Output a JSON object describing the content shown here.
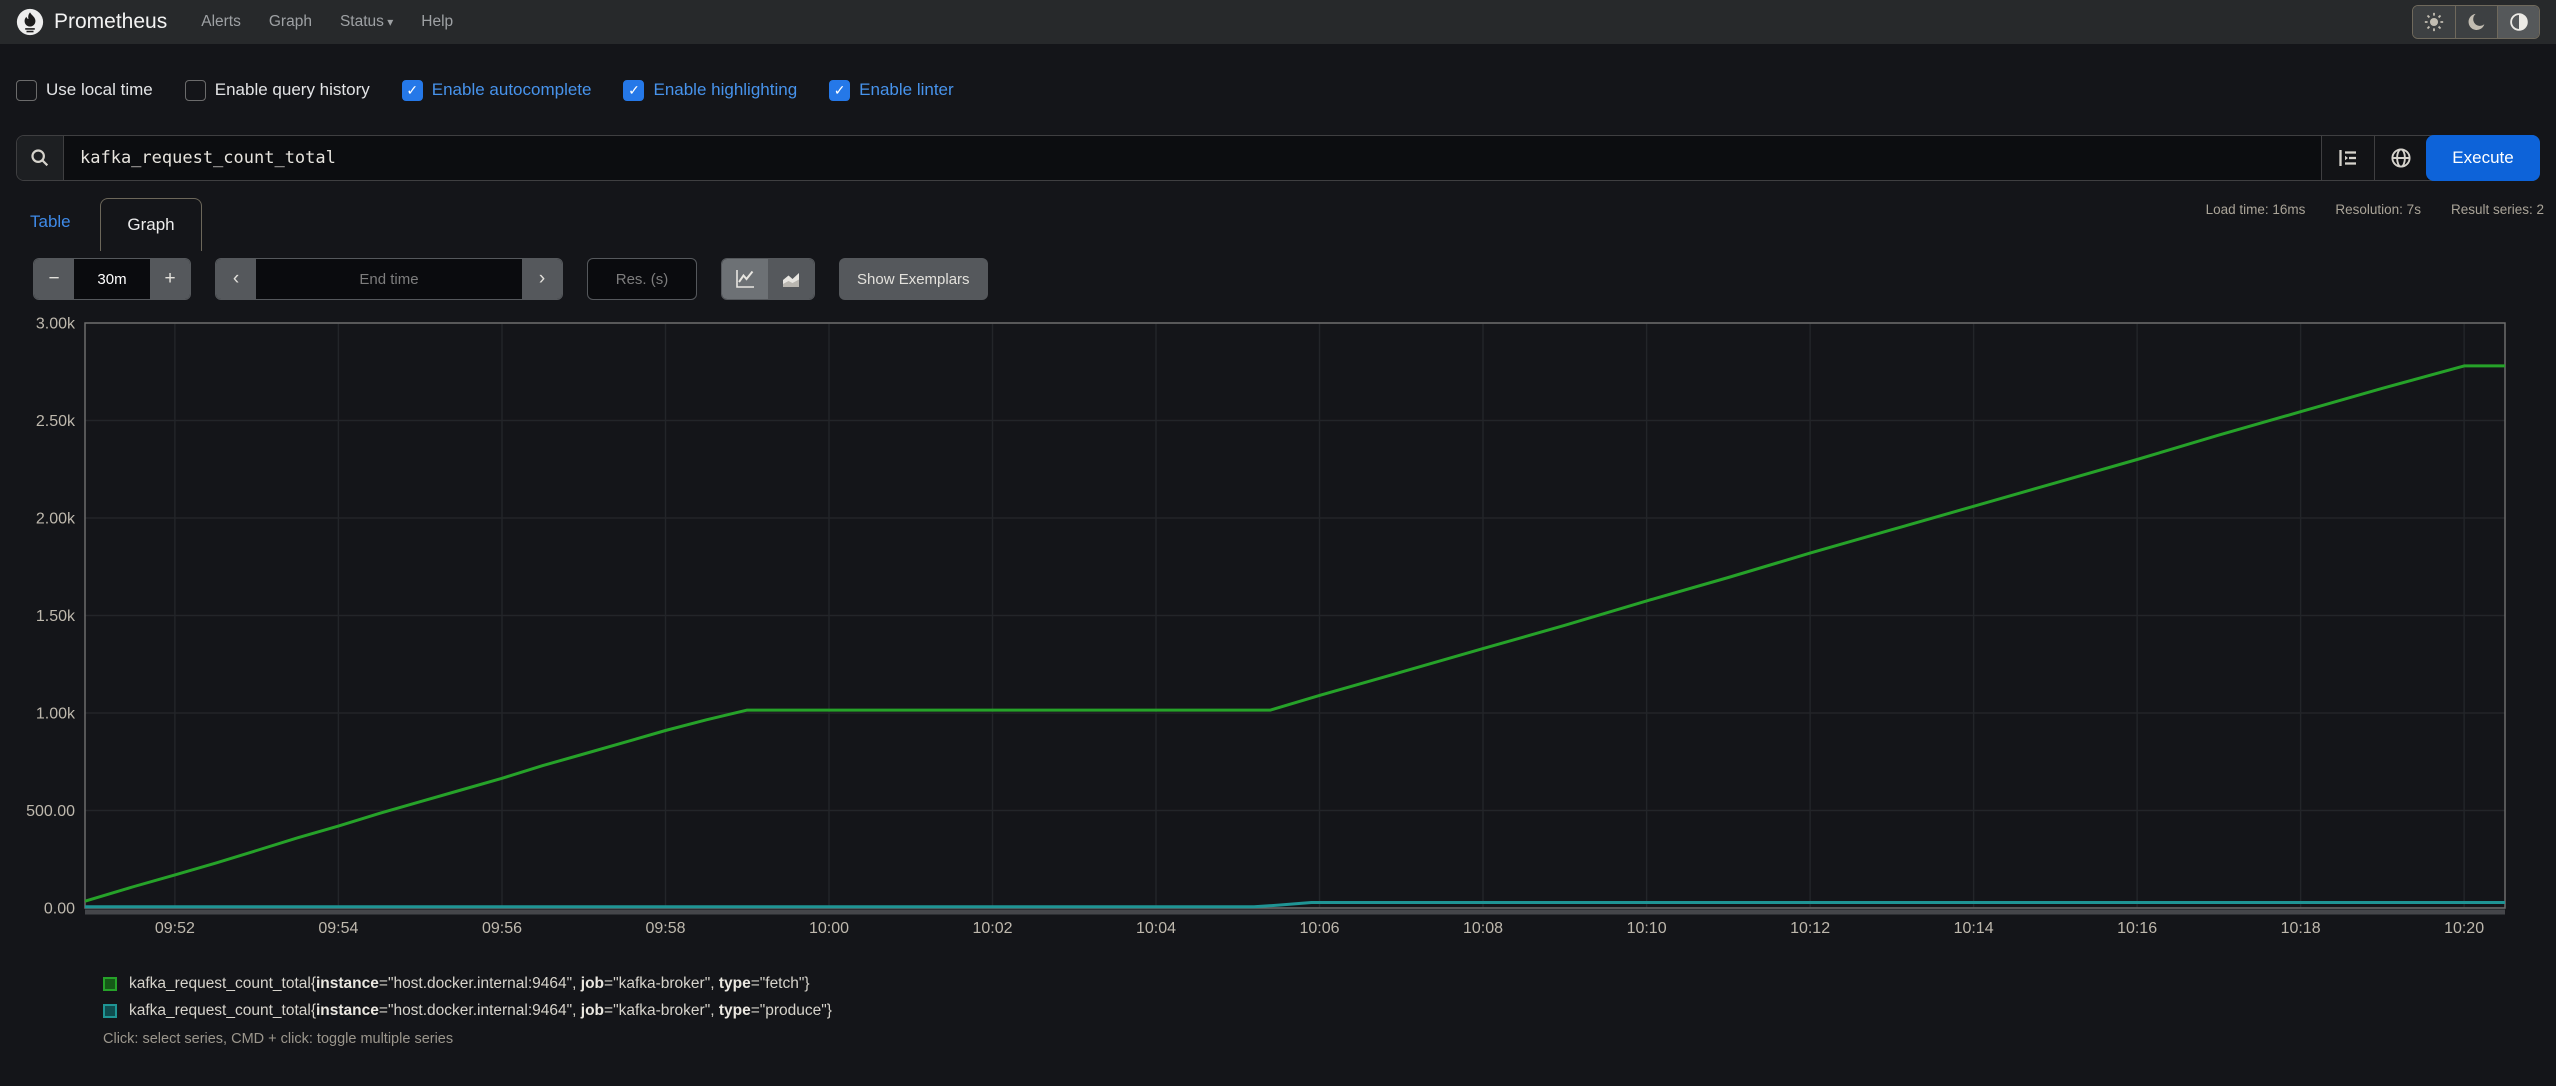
{
  "navbar": {
    "brand": "Prometheus",
    "items": [
      {
        "label": "Alerts",
        "dropdown": false
      },
      {
        "label": "Graph",
        "dropdown": false
      },
      {
        "label": "Status",
        "dropdown": true
      },
      {
        "label": "Help",
        "dropdown": false
      }
    ],
    "theme_buttons": [
      {
        "name": "light-theme-button",
        "icon": "sun-icon",
        "active": false
      },
      {
        "name": "dark-theme-button",
        "icon": "moon-icon",
        "active": false
      },
      {
        "name": "auto-theme-button",
        "icon": "half-circle-icon",
        "active": true
      }
    ]
  },
  "options": {
    "checkboxes": [
      {
        "label": "Use local time",
        "checked": false
      },
      {
        "label": "Enable query history",
        "checked": false
      },
      {
        "label": "Enable autocomplete",
        "checked": true
      },
      {
        "label": "Enable highlighting",
        "checked": true
      },
      {
        "label": "Enable linter",
        "checked": true
      }
    ]
  },
  "query": {
    "value": "kafka_request_count_total",
    "execute_label": "Execute"
  },
  "tabs": {
    "table": "Table",
    "graph": "Graph"
  },
  "stats": {
    "load_time": "Load time: 16ms",
    "resolution": "Resolution: 7s",
    "result_series": "Result series: 2"
  },
  "controls": {
    "minus": "−",
    "duration": "30m",
    "plus": "+",
    "prev": "‹",
    "end_time_placeholder": "End time",
    "next": "›",
    "res_placeholder": "Res. (s)",
    "show_exemplars": "Show Exemplars"
  },
  "chart_data": {
    "type": "line",
    "title": "kafka_request_count_total over last 30m",
    "grid": true,
    "legend_position": "bottom",
    "x_axis": {
      "unit": "time (HH:MM)",
      "range_minutes": [
        0.9,
        30.5
      ],
      "tick_minutes": [
        2,
        4,
        6,
        8,
        10,
        12,
        14,
        16,
        18,
        20,
        22,
        24,
        26,
        28,
        30
      ],
      "ticks": [
        "09:52",
        "09:54",
        "09:56",
        "09:58",
        "10:00",
        "10:02",
        "10:04",
        "10:06",
        "10:08",
        "10:10",
        "10:12",
        "10:14",
        "10:16",
        "10:18",
        "10:20"
      ]
    },
    "y_axis": {
      "range": [
        0,
        3000
      ],
      "tick_values": [
        0,
        500,
        1000,
        1500,
        2000,
        2500,
        3000
      ],
      "tick_labels": [
        "0.00",
        "500.00",
        "1.00k",
        "1.50k",
        "2.00k",
        "2.50k",
        "3.00k"
      ]
    },
    "series": [
      {
        "metric": "kafka_request_count_total",
        "labels": [
          {
            "key": "instance",
            "value": "host.docker.internal:9464"
          },
          {
            "key": "job",
            "value": "kafka-broker"
          },
          {
            "key": "type",
            "value": "fetch"
          }
        ],
        "color": "#26a229",
        "swatch_fill": "#155a17",
        "points": [
          [
            0.9,
            35
          ],
          [
            1.5,
            110
          ],
          [
            2,
            170
          ],
          [
            2.5,
            230
          ],
          [
            3,
            295
          ],
          [
            3.5,
            360
          ],
          [
            4,
            420
          ],
          [
            4.5,
            485
          ],
          [
            5,
            545
          ],
          [
            5.5,
            605
          ],
          [
            6,
            665
          ],
          [
            6.5,
            730
          ],
          [
            7,
            790
          ],
          [
            7.5,
            850
          ],
          [
            8,
            910
          ],
          [
            8.5,
            965
          ],
          [
            9,
            1015
          ],
          [
            15.4,
            1015
          ],
          [
            16,
            1090
          ],
          [
            17,
            1210
          ],
          [
            18,
            1330
          ],
          [
            19,
            1450
          ],
          [
            20,
            1575
          ],
          [
            21,
            1695
          ],
          [
            22,
            1820
          ],
          [
            23,
            1940
          ],
          [
            24,
            2060
          ],
          [
            25,
            2180
          ],
          [
            26,
            2300
          ],
          [
            27,
            2425
          ],
          [
            28,
            2545
          ],
          [
            29,
            2665
          ],
          [
            30,
            2780
          ],
          [
            30.5,
            2780
          ]
        ]
      },
      {
        "metric": "kafka_request_count_total",
        "labels": [
          {
            "key": "instance",
            "value": "host.docker.internal:9464"
          },
          {
            "key": "job",
            "value": "kafka-broker"
          },
          {
            "key": "type",
            "value": "produce"
          }
        ],
        "color": "#1f9494",
        "swatch_fill": "#0f4d4f",
        "points": [
          [
            0.9,
            6
          ],
          [
            15.2,
            6
          ],
          [
            15.5,
            15
          ],
          [
            15.9,
            28
          ],
          [
            30.5,
            28
          ]
        ]
      }
    ]
  },
  "legend_hint": "Click: select series, CMD + click: toggle multiple series",
  "colors": {
    "accent_blue": "#0d63d9",
    "link_blue": "#3f8ae8",
    "checked_label_blue": "#4793ec",
    "series_green": "#26a229",
    "series_teal": "#1f9494",
    "navbar_bg": "#27292b",
    "page_bg": "#141519"
  }
}
